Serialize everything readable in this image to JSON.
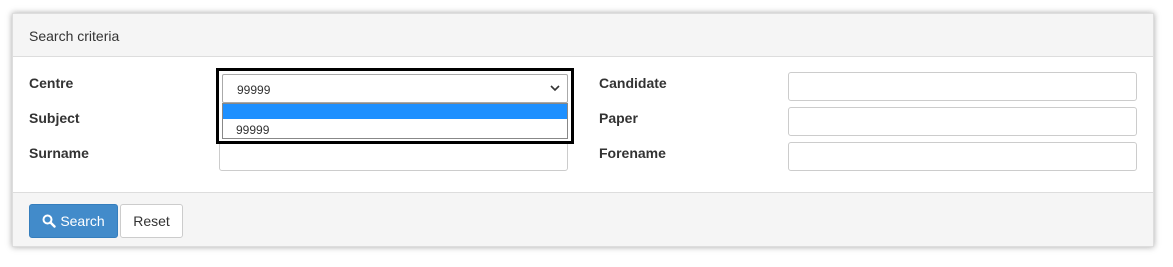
{
  "panel": {
    "title": "Search criteria"
  },
  "form": {
    "centre": {
      "label": "Centre",
      "selected": "99999",
      "options": [
        "",
        "99999"
      ]
    },
    "subject": {
      "label": "Subject"
    },
    "surname": {
      "label": "Surname"
    },
    "candidate": {
      "label": "Candidate"
    },
    "paper": {
      "label": "Paper"
    },
    "forename": {
      "label": "Forename"
    }
  },
  "footer": {
    "search_label": "Search",
    "reset_label": "Reset"
  },
  "icons": {
    "search": "search-icon",
    "chevron": "chevron-down-icon"
  },
  "colors": {
    "primary": "#428bca",
    "highlight": "#1e90ff",
    "panel_bg": "#f5f5f5",
    "focus_border": "#000000"
  }
}
